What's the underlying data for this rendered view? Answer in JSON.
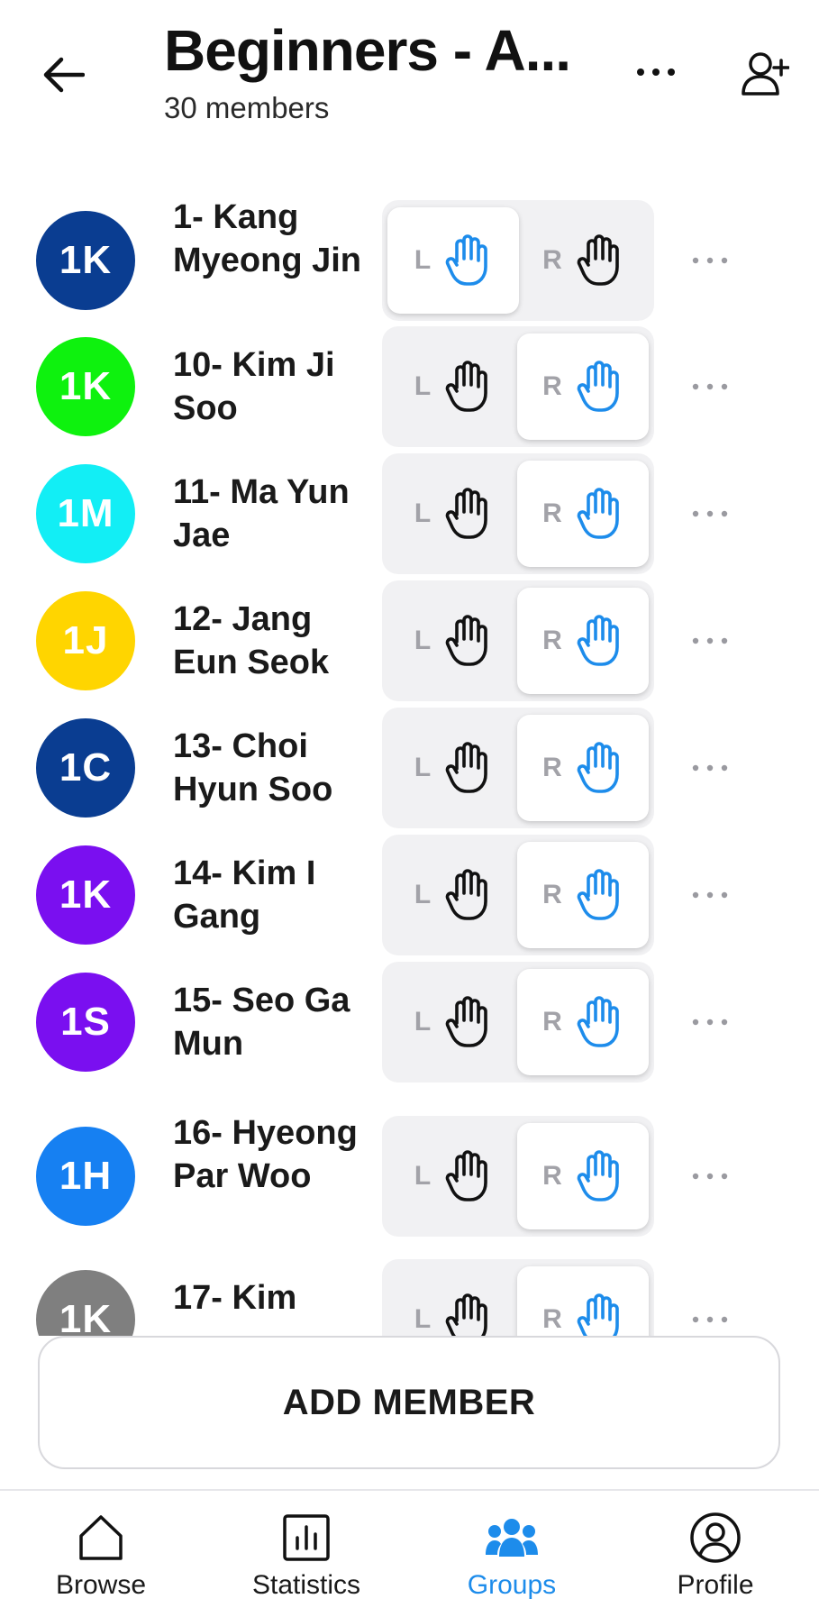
{
  "header": {
    "title": "Beginners - A...",
    "subtitle": "30 members",
    "back_icon": "arrow-left-icon",
    "more_icon": "more-horizontal-icon",
    "add_user_icon": "user-plus-icon"
  },
  "colors": {
    "accent": "#1d8ceb",
    "toggle_bg": "#f1f1f3",
    "letter_gray": "#a2a2a8"
  },
  "members": [
    {
      "initials": "1K",
      "name": "1- Kang Myeong Jin",
      "color": "#0a3d91",
      "hand_left_label": "L",
      "hand_right_label": "R",
      "selected": "L"
    },
    {
      "initials": "1K",
      "name": "10- Kim Ji Soo",
      "color": "#0ef20e",
      "hand_left_label": "L",
      "hand_right_label": "R",
      "selected": "R"
    },
    {
      "initials": "1M",
      "name": "11- Ma Yun Jae",
      "color": "#12eef5",
      "hand_left_label": "L",
      "hand_right_label": "R",
      "selected": "R"
    },
    {
      "initials": "1J",
      "name": "12- Jang Eun Seok",
      "color": "#ffd500",
      "hand_left_label": "L",
      "hand_right_label": "R",
      "selected": "R"
    },
    {
      "initials": "1C",
      "name": "13- Choi Hyun Soo",
      "color": "#0a3d91",
      "hand_left_label": "L",
      "hand_right_label": "R",
      "selected": "R"
    },
    {
      "initials": "1K",
      "name": "14- Kim I Gang",
      "color": "#7a0ff0",
      "hand_left_label": "L",
      "hand_right_label": "R",
      "selected": "R"
    },
    {
      "initials": "1S",
      "name": "15- Seo Ga Mun",
      "color": "#7a0ff0",
      "hand_left_label": "L",
      "hand_right_label": "R",
      "selected": "R"
    },
    {
      "initials": "1H",
      "name": "16- Hyeong Par Woo",
      "color": "#1680f2",
      "hand_left_label": "L",
      "hand_right_label": "R",
      "selected": "R"
    },
    {
      "initials": "1K",
      "name": "17- Kim",
      "color": "#7f7f7f",
      "hand_left_label": "L",
      "hand_right_label": "R",
      "selected": "R"
    }
  ],
  "add_member_label": "ADD MEMBER",
  "nav": [
    {
      "label": "Browse",
      "icon": "home-icon",
      "active": false
    },
    {
      "label": "Statistics",
      "icon": "bar-chart-icon",
      "active": false
    },
    {
      "label": "Groups",
      "icon": "group-icon",
      "active": true
    },
    {
      "label": "Profile",
      "icon": "user-circle-icon",
      "active": false
    }
  ]
}
